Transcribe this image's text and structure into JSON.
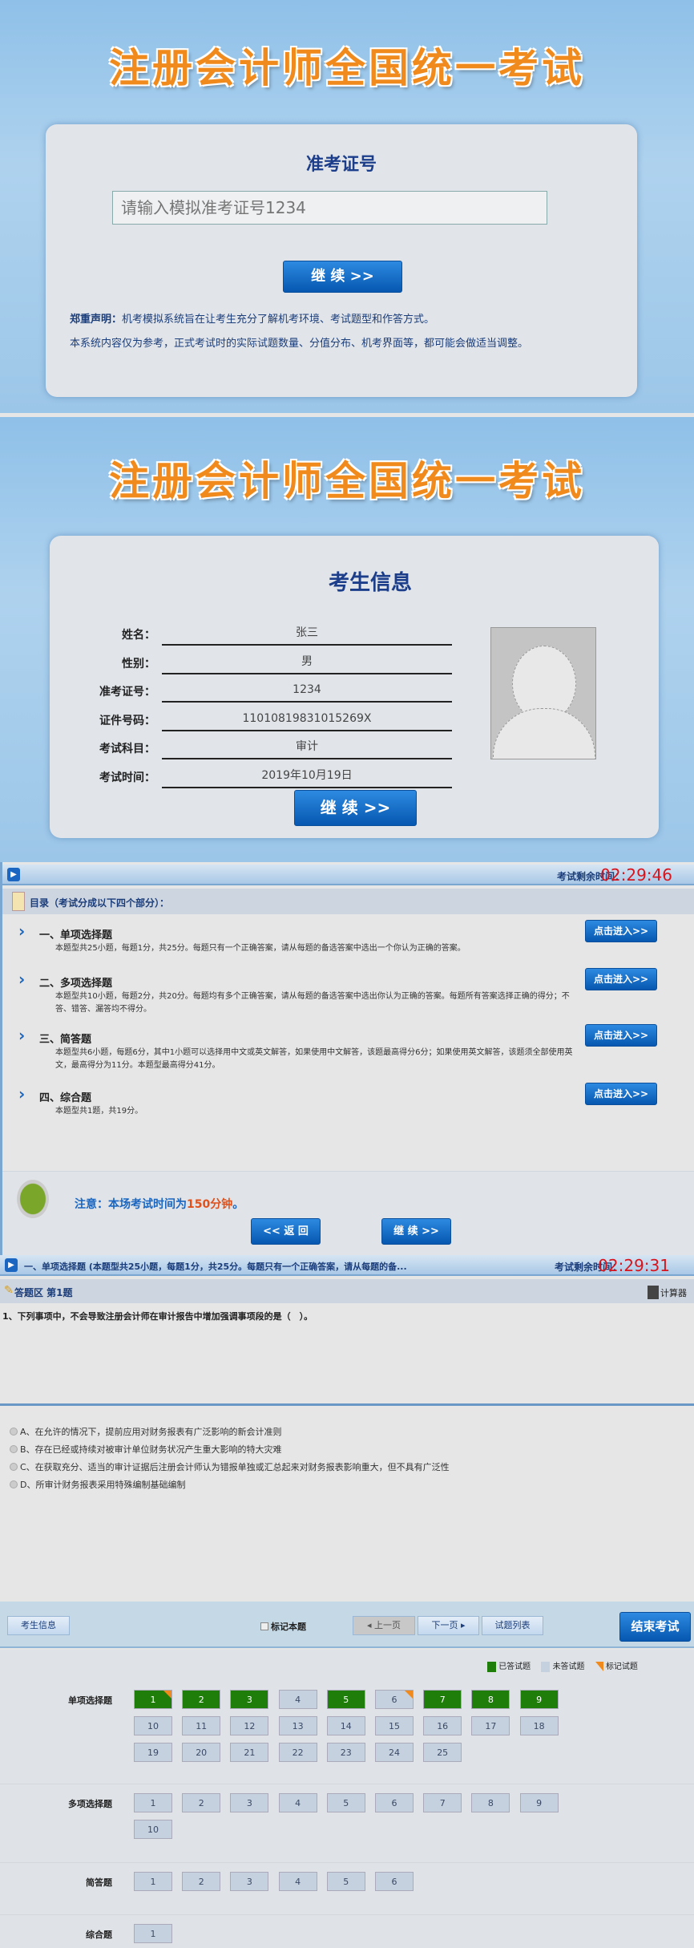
{
  "banner_title": "注册会计师全国统一考试",
  "login": {
    "heading": "准考证号",
    "input_placeholder": "请输入模拟准考证号1234",
    "continue": "继 续 >>",
    "disclaimer_label": "郑重声明：",
    "disclaimer_1": "机考模拟系统旨在让考生充分了解机考环境、考试题型和作答方式。",
    "disclaimer_2": "本系统内容仅为参考，正式考试时的实际试题数量、分值分布、机考界面等，都可能会做适当调整。"
  },
  "info": {
    "heading": "考生信息",
    "rows": [
      {
        "label": "姓名：",
        "value": "张三"
      },
      {
        "label": "性别：",
        "value": "男"
      },
      {
        "label": "准考证号：",
        "value": "1234"
      },
      {
        "label": "证件号码：",
        "value": "11010819831015269X"
      },
      {
        "label": "考试科目：",
        "value": "审计"
      },
      {
        "label": "考试时间：",
        "value": "2019年10月19日"
      }
    ],
    "continue": "继 续 >>"
  },
  "directory": {
    "timer_label": "考试剩余时间：",
    "timer": "02:29:46",
    "title": "目录（考试分成以下四个部分）：",
    "enter": "点击进入>>",
    "items": [
      {
        "title": "一、单项选择题",
        "desc": "本题型共25小题，每题1分，共25分。每题只有一个正确答案，请从每题的备选答案中选出一个你认为正确的答案。"
      },
      {
        "title": "二、多项选择题",
        "desc": "本题型共10小题，每题2分，共20分。每题均有多个正确答案，请从每题的备选答案中选出你认为正确的答案。每题所有答案选择正确的得分；不答、错答、漏答均不得分。"
      },
      {
        "title": "三、简答题",
        "desc": "本题型共6小题，每题6分，其中1小题可以选择用中文或英文解答，如果使用中文解答，该题最高得分6分；如果使用英文解答，该题须全部使用英文，最高得分为11分。本题型最高得分41分。"
      },
      {
        "title": "四、综合题",
        "desc": "本题型共1题，共19分。"
      }
    ],
    "notice_prefix": "注意：本场考试时间为",
    "notice_time": "150分钟",
    "notice_suffix": "。",
    "back": "<< 返 回",
    "continue": "继 续 >>"
  },
  "exam": {
    "header": "一、单项选择题 (本题型共25小题，每题1分，共25分。每题只有一个正确答案，请从每题的备...",
    "timer_label": "考试剩余时间：",
    "timer": "02:29:31",
    "area": "答题区 第1题",
    "calculator": "计算器",
    "question": "1、下列事项中，不会导致注册会计师在审计报告中增加强调事项段的是（　）。",
    "options": [
      "A、在允许的情况下，提前应用对财务报表有广泛影响的新会计准则",
      "B、存在已经或持续对被审计单位财务状况产生重大影响的特大灾难",
      "C、在获取充分、适当的审计证据后注册会计师认为错报单独或汇总起来对财务报表影响重大，但不具有广泛性",
      "D、所审计财务报表采用特殊编制基础编制"
    ],
    "toolbar": {
      "student_info": "考生信息",
      "mark": "标记本题",
      "prev": "◂ 上一页",
      "next": "下一页 ▸",
      "list": "试题列表",
      "end": "结束考试"
    },
    "legend": {
      "answered": "已答试题",
      "unanswered": "未答试题",
      "marked": "标记试题"
    },
    "groups": [
      {
        "label": "单项选择题",
        "count": 25,
        "answered": [
          1,
          2,
          3,
          5,
          7,
          8,
          9
        ],
        "marked": [
          1,
          6
        ]
      },
      {
        "label": "多项选择题",
        "count": 10,
        "answered": [],
        "marked": []
      },
      {
        "label": "简答题",
        "count": 6,
        "answered": [],
        "marked": []
      },
      {
        "label": "综合题",
        "count": 1,
        "answered": [],
        "marked": []
      }
    ]
  },
  "colors": {
    "accent": "#0657b0",
    "timer": "#d8141c",
    "answered": "#1f7d0a",
    "marked": "#f08a1c"
  }
}
